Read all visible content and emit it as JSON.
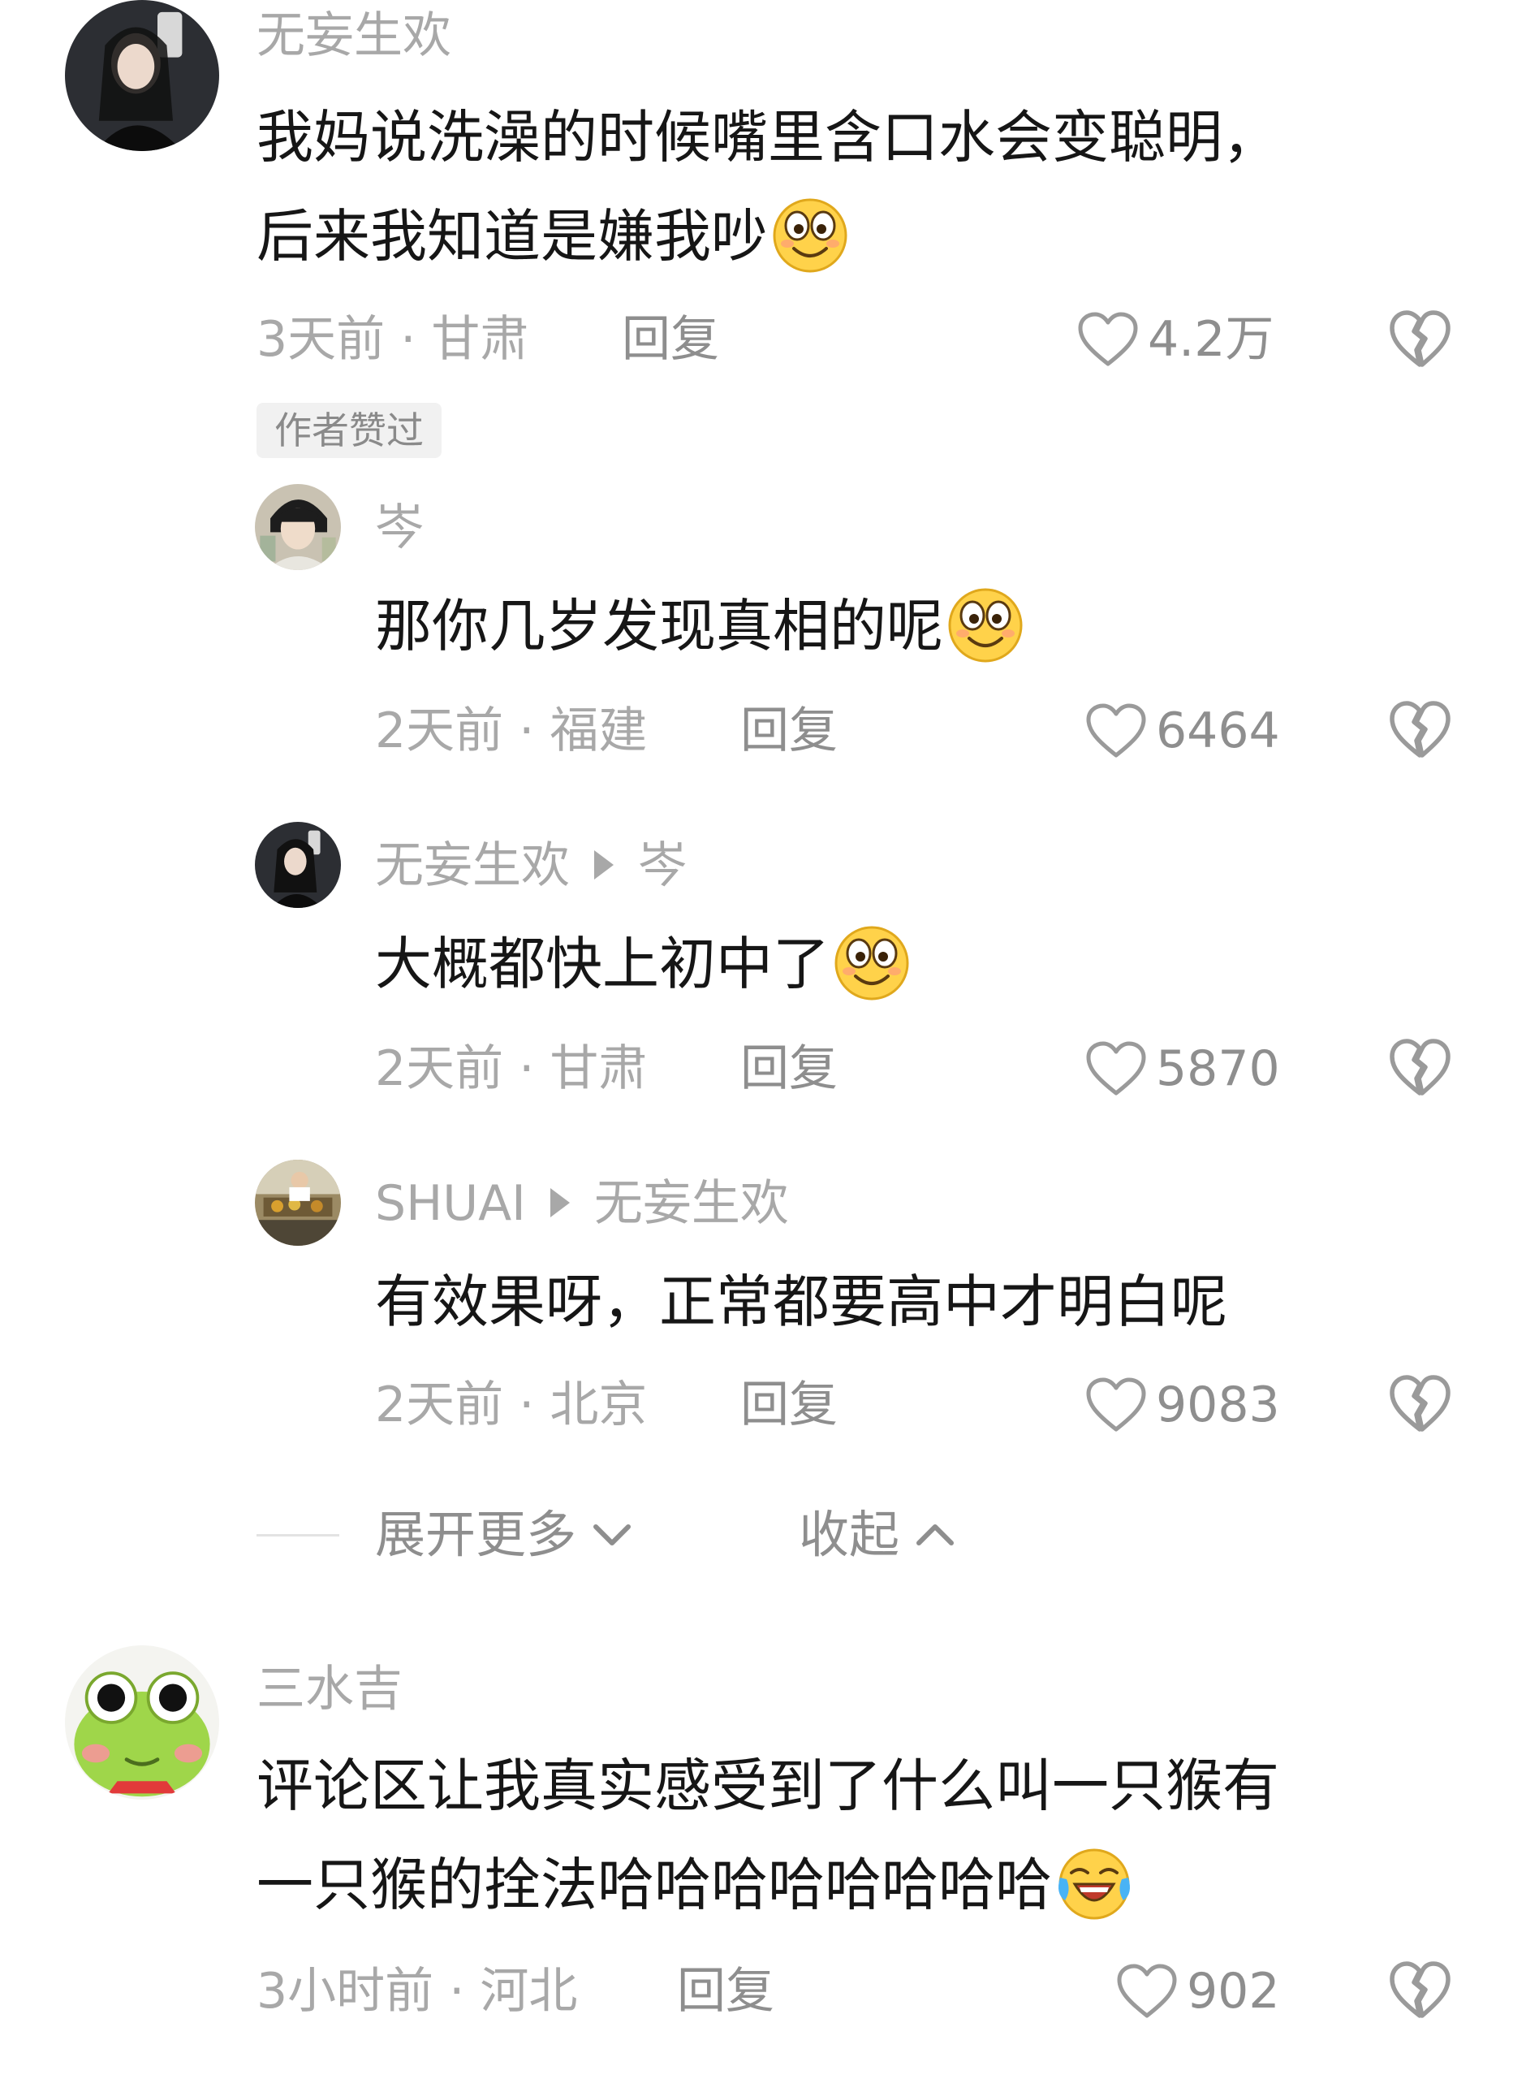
{
  "comments": [
    {
      "username": "无妄生欢",
      "text_line1": "我妈说洗澡的时候嘴里含口水会变聪明，",
      "text_line2": "后来我知道是嫌我吵",
      "emoji": "grinning-face-emoji",
      "meta": "3天前 · 甘肃",
      "reply_label": "回复",
      "likes": "4.2万",
      "badge": "作者赞过"
    },
    {
      "username": "岑",
      "text": "那你几岁发现真相的呢",
      "emoji": "grinning-face-emoji",
      "meta": "2天前 · 福建",
      "reply_label": "回复",
      "likes": "6464"
    },
    {
      "username": "无妄生欢",
      "reply_to": "岑",
      "text": "大概都快上初中了",
      "emoji": "grinning-face-emoji",
      "meta": "2天前 · 甘肃",
      "reply_label": "回复",
      "likes": "5870"
    },
    {
      "username": "SHUAI",
      "reply_to": "无妄生欢",
      "text": "有效果呀，正常都要高中才明白呢",
      "meta": "2天前 · 北京",
      "reply_label": "回复",
      "likes": "9083"
    },
    {
      "username": "三水吉",
      "text_line1": "评论区让我真实感受到了什么叫一只猴有",
      "text_line2": "一只猴的拴法哈哈哈哈哈哈哈哈",
      "emoji": "laughing-crying-emoji",
      "meta": "3小时前 · 河北",
      "reply_label": "回复",
      "likes": "902"
    }
  ],
  "thread_controls": {
    "expand_label": "展开更多",
    "collapse_label": "收起"
  },
  "icons": {
    "like": "heart-outline-icon",
    "dislike": "broken-heart-icon",
    "expand": "chevron-down-icon",
    "collapse": "chevron-up-icon"
  },
  "colors": {
    "text": "#161616",
    "muted": "#a8a8a8",
    "emoji_yellow": "#ffd24a"
  }
}
